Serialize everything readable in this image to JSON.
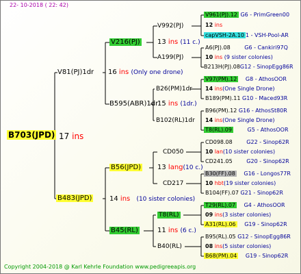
{
  "date": "22- 10-2018 ( 22: 42)",
  "root": {
    "name": "B703(JPD)",
    "num": "17",
    "ins": "ins"
  },
  "gen1": [
    {
      "name": "V81(PJ)1dr",
      "num": "16",
      "ins": "ins",
      "note": "(Only one drone)"
    },
    {
      "name": "B483(JPD)",
      "num": "14",
      "ins": "ins",
      "note": "(10 sister colonies)"
    }
  ],
  "gen2": [
    {
      "name": "V216(PJ)",
      "num": "13",
      "ins": "ins",
      "note": "(11 c.)"
    },
    {
      "name": "B595(ABR)1dr",
      "num": "15",
      "ins": "ins",
      "note": "(1dr.)"
    },
    {
      "name": "B56(JPD)",
      "num": "13",
      "ins": "lang",
      "note": "(10 c.)"
    },
    {
      "name": "B45(RL)",
      "num": "11",
      "ins": "ins",
      "note": "(6 c.)"
    }
  ],
  "gen3": [
    {
      "name": "V992(PJ)",
      "num": "12",
      "ins": "ins"
    },
    {
      "name": "A199(PJ)"
    },
    {
      "name": "B26(PM)1dr",
      "num": "14",
      "ins": "ins",
      "note": "(One Single Drone)"
    },
    {
      "name": "B102(RL)1dr"
    },
    {
      "name": "CD050",
      "num": "13",
      "ins": "lang"
    },
    {
      "name": "CD217"
    },
    {
      "name": "T8(RL)",
      "num": "11",
      "ins": "ins"
    },
    {
      "name": "B40(RL)"
    }
  ],
  "gen4": [
    {
      "name": "V961(PJ).12",
      "group": "G6 - PrimGreen00"
    },
    {
      "num": "12",
      "ins": "ins"
    },
    {
      "name": "capVSH-2A.10",
      "group": "1 - VSH-Pool-AR"
    },
    {
      "name": "A6(PJ).08",
      "group": "G6 - Cankiri97Q"
    },
    {
      "num": "10",
      "ins": "ins",
      "note": "(9 sister colonies)"
    },
    {
      "name": "B213H(PJ).08",
      "group": "G12 - SinopEgg86R"
    },
    {
      "name": "V97(PM).12",
      "group": "G8 - AthosOOR"
    },
    {
      "num": "14",
      "ins": "ins",
      "note": "(One Single Drone)"
    },
    {
      "name": "B189(PM).11",
      "group": "G10 - Maced93R"
    },
    {
      "name": "B96(PM).12",
      "group": "G16 - AthosSt80R"
    },
    {
      "num": "14",
      "ins": "ins",
      "note": "(One Single Drone)"
    },
    {
      "name": "T8(RL).09",
      "group": "G5 - AthosOOR"
    },
    {
      "name": "CD098.08",
      "group": "G22 - Sinop62R"
    },
    {
      "num": "10",
      "ins": "lan",
      "note": "(10 sister colonies)"
    },
    {
      "name": "CD241.05",
      "group": "G20 - Sinop62R"
    },
    {
      "name": "B30(FF).08",
      "group": "G16 - Longos77R"
    },
    {
      "num": "10",
      "ins": "hbt",
      "note": "(19 sister colonies)"
    },
    {
      "name": "B104(FF).07",
      "group": "G21 - Sinop62R"
    },
    {
      "name": "T29(RL).07",
      "group": "G4 - AthosOOR"
    },
    {
      "num": "09",
      "ins": "ins",
      "note": "(3 sister colonies)"
    },
    {
      "name": "A31(RL).06",
      "group": "G19 - Sinop62R"
    },
    {
      "name": "B95(RL).05",
      "group": "G12 - SinopEgg86R"
    },
    {
      "num": "08",
      "ins": "ins",
      "note": "(5 sister colonies)"
    },
    {
      "name": "B68(PM).04",
      "group": "G19 - Sinop62R"
    }
  ],
  "copyright": "Copyright 2004-2018 @ Karl Kehrle Foundation    www.pedigreeapis.org"
}
